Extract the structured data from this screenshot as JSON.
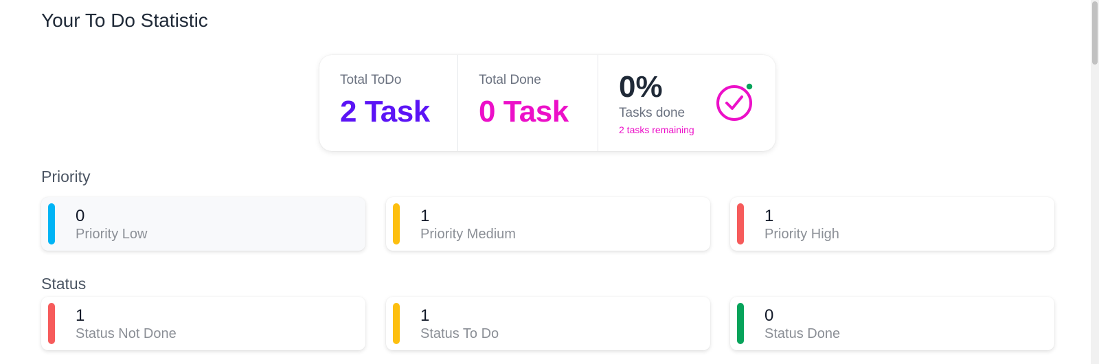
{
  "page": {
    "title": "Your To Do Statistic"
  },
  "summary": {
    "total_todo": {
      "label": "Total ToDo",
      "value": "2 Task"
    },
    "total_done": {
      "label": "Total Done",
      "value": "0 Task"
    },
    "progress": {
      "percent": "0%",
      "label": "Tasks done",
      "remaining": "2 tasks remaining"
    }
  },
  "priority": {
    "title": "Priority",
    "cards": [
      {
        "value": "0",
        "label": "Priority Low",
        "color": "#00b4f5"
      },
      {
        "value": "1",
        "label": "Priority Medium",
        "color": "#fdbf0f"
      },
      {
        "value": "1",
        "label": "Priority High",
        "color": "#f65b5b"
      }
    ]
  },
  "status": {
    "title": "Status",
    "cards": [
      {
        "value": "1",
        "label": "Status Not Done",
        "color": "#f65b5b"
      },
      {
        "value": "1",
        "label": "Status To Do",
        "color": "#fdbf0f"
      },
      {
        "value": "0",
        "label": "Status Done",
        "color": "#07a35a"
      }
    ]
  },
  "icons": {
    "check": "check-circle-icon",
    "check_color": "#ec10c8",
    "dot_color": "#07a35a"
  }
}
